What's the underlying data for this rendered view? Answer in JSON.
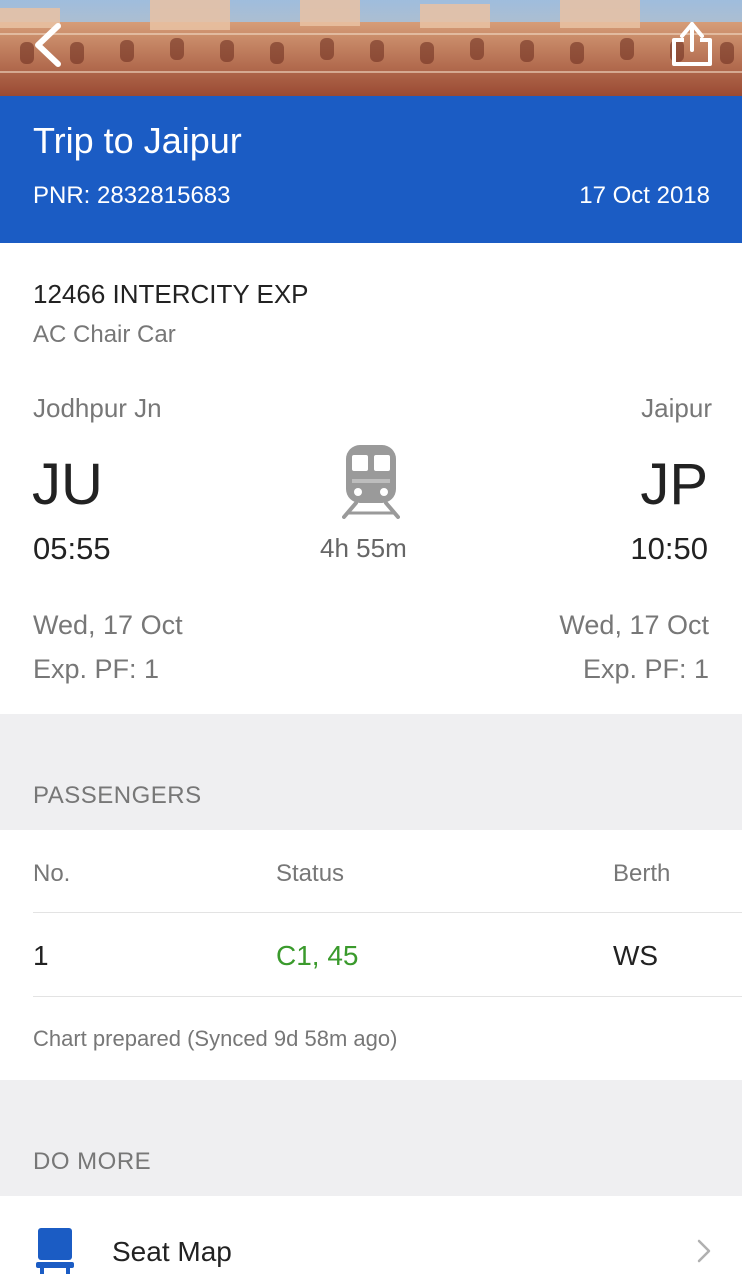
{
  "header": {
    "back_icon": "chevron-left-icon",
    "share_icon": "share-icon"
  },
  "trip": {
    "title": "Trip to Jaipur",
    "pnr": "PNR: 2832815683",
    "date": "17 Oct 2018"
  },
  "train": {
    "name": "12466 INTERCITY EXP",
    "class": "AC Chair Car",
    "from": {
      "station": "Jodhpur Jn",
      "code": "JU",
      "time": "05:55",
      "date": "Wed, 17 Oct",
      "platform": "Exp. PF: 1"
    },
    "to": {
      "station": "Jaipur",
      "code": "JP",
      "time": "10:50",
      "date": "Wed, 17 Oct",
      "platform": "Exp. PF: 1"
    },
    "duration": "4h 55m",
    "icon": "train-icon"
  },
  "passengers": {
    "section_label": "PASSENGERS",
    "headers": [
      "No.",
      "Status",
      "Berth"
    ],
    "rows": [
      {
        "no": "1",
        "status": "C1, 45",
        "berth": "WS"
      }
    ],
    "chart_note": "Chart prepared (Synced 9d 58m ago)"
  },
  "do_more": {
    "section_label": "DO MORE",
    "items": [
      {
        "label": "Seat Map",
        "icon": "seat-icon"
      }
    ]
  },
  "colors": {
    "banner": "#1b5cc4",
    "status_confirmed": "#3a9a2c",
    "section_bg": "#efeff1"
  }
}
